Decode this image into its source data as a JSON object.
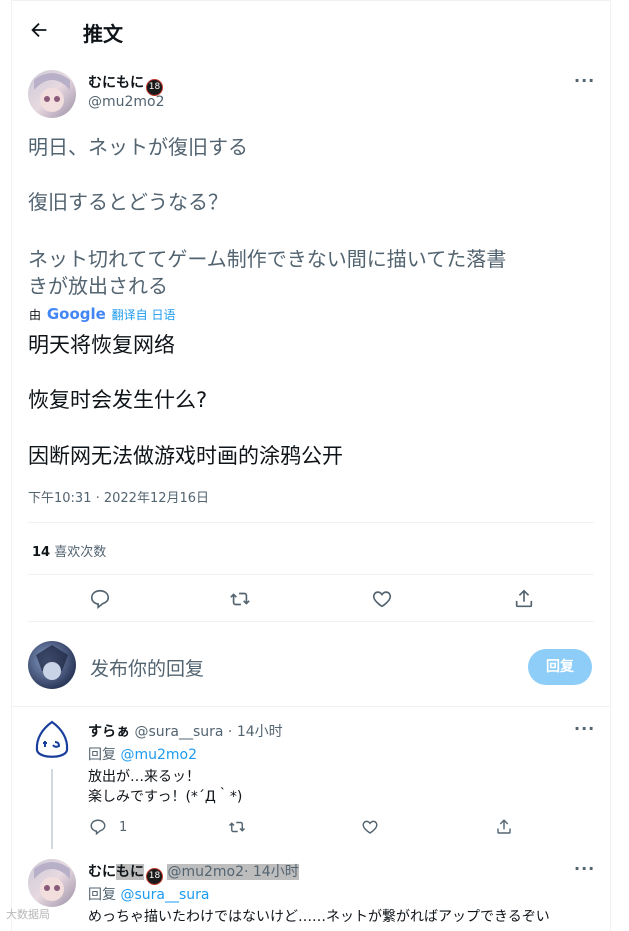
{
  "header": {
    "title": "推文"
  },
  "tweet": {
    "author_name": "むにもに",
    "badge": "18",
    "handle": "@mu2mo2",
    "text_lines": [
      "明日、ネットが復旧する",
      "復旧するとどうなる？",
      "ネット切れててゲーム制作できない間に描いてた落書",
      "きが放出される"
    ],
    "translate_prefix": "由",
    "translate_brand": "Google",
    "translate_link": "翻译自 日语",
    "translated_lines": [
      "明天将恢复网络",
      "恢复时会发生什么?",
      "因断网无法做游戏时画的涂鸦公开"
    ],
    "timestamp": "下午10:31 · 2022年12月16日",
    "likes_count": "14",
    "likes_label": "喜欢次数"
  },
  "composer": {
    "placeholder": "发布你的回复",
    "button": "回复"
  },
  "replies": [
    {
      "author_name": "すらぁ",
      "handle": "@sura__sura",
      "time": "· 14小时",
      "reply_prefix": "回复",
      "reply_to": "@mu2mo2",
      "lines": [
        "放出が…来るッ！",
        "楽しみですっ！(*´Д｀*)"
      ],
      "reply_count": "1"
    },
    {
      "author_name_a": "むに",
      "author_name_b": "もに",
      "badge": "18",
      "handle": "@mu2mo2",
      "time": "· 14小时",
      "reply_prefix": "回复",
      "reply_to": "@sura__sura",
      "lines": [
        "めっちゃ描いたわけではないけど……ネットが繋がればアップできるぞい"
      ]
    }
  ],
  "watermark": "大数据局",
  "colors": {
    "accent": "#1d9bf0",
    "reply_button": "#8ecdf8",
    "muted": "#536471"
  }
}
